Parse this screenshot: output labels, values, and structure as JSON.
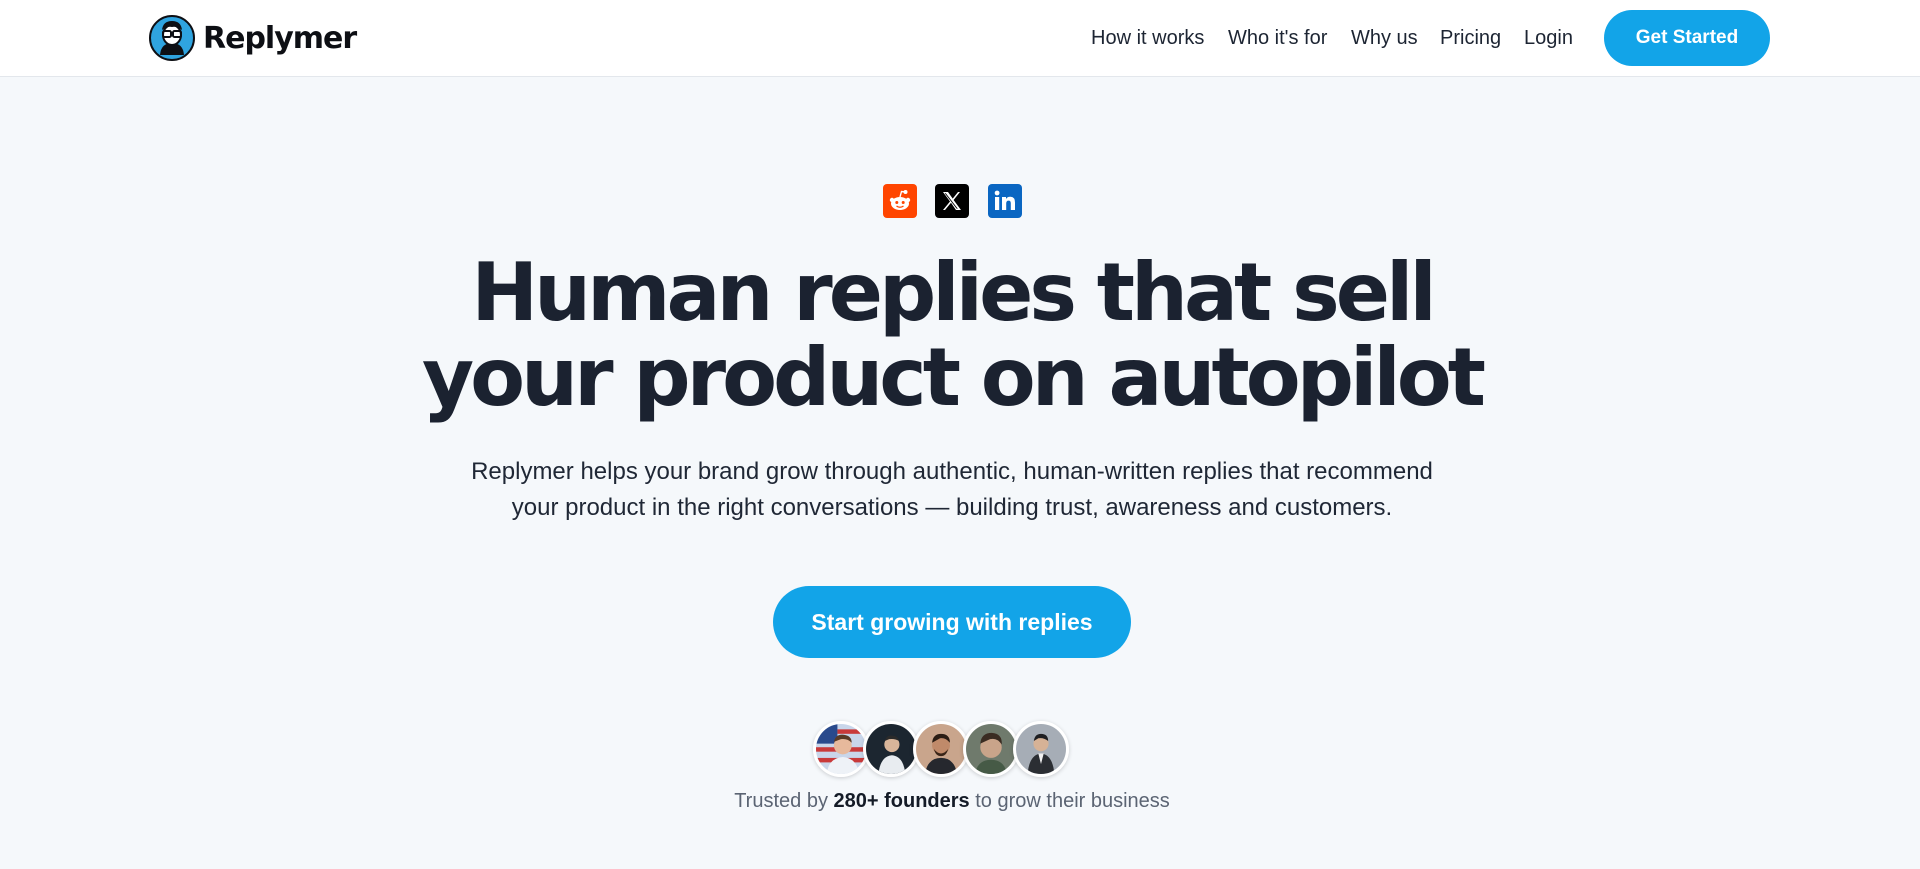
{
  "header": {
    "brand_name": "Replymer",
    "nav": [
      {
        "label": "How it works"
      },
      {
        "label": "Who it's for"
      },
      {
        "label": "Why us"
      },
      {
        "label": "Pricing"
      },
      {
        "label": "Login"
      }
    ],
    "cta_label": "Get Started"
  },
  "hero": {
    "social_icons": [
      "reddit-icon",
      "x-icon",
      "linkedin-icon"
    ],
    "headline_line1": "Human replies that sell",
    "headline_line2": "your product on autopilot",
    "subhead_line1": "Replymer helps your brand grow through authentic, human-written replies that recommend",
    "subhead_line2": "your product in the right conversations — building trust, awareness and customers.",
    "cta_label": "Start growing with replies",
    "trusted_prefix": "Trusted by",
    "trusted_highlight": "280+ founders",
    "trusted_suffix": "to grow their business"
  },
  "colors": {
    "accent": "#12a4e8",
    "background": "#f5f8fb",
    "text": "#1b2230",
    "reddit": "#ff4500",
    "x": "#000000",
    "linkedin": "#0a66c2"
  }
}
